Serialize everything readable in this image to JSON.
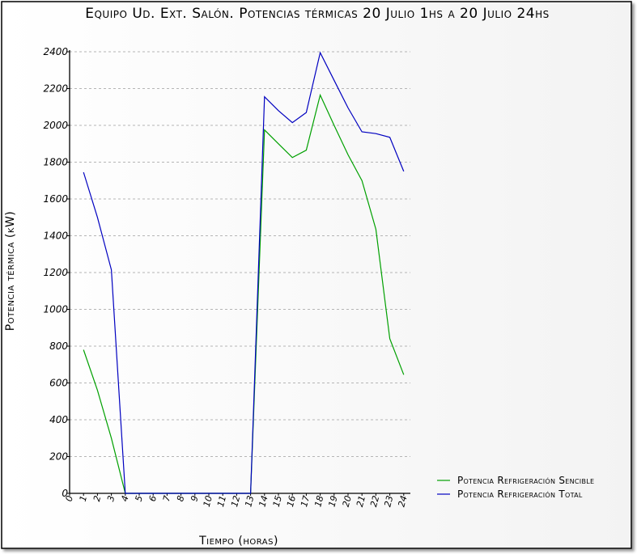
{
  "chart_data": {
    "type": "line",
    "title": "Equipo Ud. Ext. Salón. Potencias térmicas 20 Julio 1hs a 20 Julio 24hs",
    "xlabel": "Tiempo (horas)",
    "ylabel": "Potencia térmica (kW)",
    "xlim": [
      0,
      24
    ],
    "ylim": [
      0,
      2400
    ],
    "x_ticks": [
      "0",
      "1",
      "2",
      "3",
      "4",
      "5",
      "6",
      "7",
      "8",
      "9",
      "10",
      "11",
      "12",
      "13",
      "14",
      "15",
      "16",
      "17",
      "18",
      "19",
      "20",
      "21",
      "22",
      "23",
      "24"
    ],
    "y_ticks": [
      "0",
      "200",
      "400",
      "600",
      "800",
      "1000",
      "1200",
      "1400",
      "1600",
      "1800",
      "2000",
      "2200",
      "2400"
    ],
    "grid": true,
    "legend_position": "bottom-right",
    "x": [
      1,
      2,
      3,
      4,
      5,
      6,
      7,
      8,
      9,
      10,
      11,
      12,
      13,
      14,
      15,
      16,
      17,
      18,
      19,
      20,
      21,
      22,
      23,
      24
    ],
    "series": [
      {
        "name": "Potencia Refrigeración Sencible",
        "color": "#00a000",
        "values": [
          780,
          560,
          300,
          0,
          0,
          0,
          0,
          0,
          0,
          0,
          0,
          0,
          0,
          1975,
          1900,
          1825,
          1865,
          2165,
          2000,
          1840,
          1700,
          1435,
          840,
          645
        ]
      },
      {
        "name": "Potencia Refrigeración Total",
        "color": "#0000c0",
        "values": [
          1745,
          1500,
          1215,
          0,
          0,
          0,
          0,
          0,
          0,
          0,
          0,
          0,
          0,
          2155,
          2080,
          2015,
          2070,
          2395,
          2245,
          2095,
          1965,
          1955,
          1935,
          1750
        ]
      }
    ]
  }
}
